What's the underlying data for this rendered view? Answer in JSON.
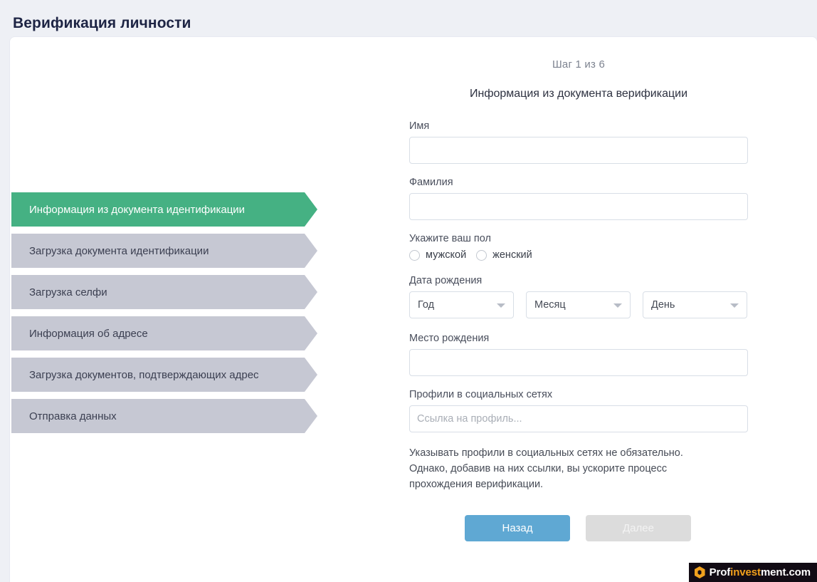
{
  "page": {
    "title": "Верификация личности",
    "colors": {
      "background": "#eef0f5",
      "card": "#ffffff",
      "step_active": "#45b183",
      "step_inactive": "#c6c8d3",
      "button_back": "#5fa8d3",
      "button_next_disabled": "#dcdcdc",
      "title_text": "#1d2444"
    }
  },
  "steps": [
    {
      "label": "Информация из документа идентификации",
      "active": true
    },
    {
      "label": "Загрузка документа идентификации",
      "active": false
    },
    {
      "label": "Загрузка селфи",
      "active": false
    },
    {
      "label": "Информация об адресе",
      "active": false
    },
    {
      "label": "Загрузка документов, подтверждающих адрес",
      "active": false
    },
    {
      "label": "Отправка данных",
      "active": false
    }
  ],
  "form": {
    "step_counter": "Шаг 1 из 6",
    "heading": "Информация из документа верификации",
    "first_name": {
      "label": "Имя",
      "value": "",
      "placeholder": ""
    },
    "last_name": {
      "label": "Фамилия",
      "value": "",
      "placeholder": ""
    },
    "gender": {
      "label": "Укажите ваш пол",
      "options": [
        {
          "label": "мужской",
          "selected": false
        },
        {
          "label": "женский",
          "selected": false
        }
      ]
    },
    "birth_date": {
      "label": "Дата рождения",
      "year": {
        "label": "Год",
        "icon": "chevron-down-icon"
      },
      "month": {
        "label": "Месяц",
        "icon": "chevron-down-icon"
      },
      "day": {
        "label": "День",
        "icon": "chevron-down-icon"
      }
    },
    "birth_place": {
      "label": "Место рождения",
      "value": "",
      "placeholder": ""
    },
    "social_profiles": {
      "label": "Профили в социальных сетях",
      "value": "",
      "placeholder": "Ссылка на профиль..."
    },
    "hint": "Указывать профили в социальных сетях не обязательно. Однако, добавив на них ссылки, вы ускорите процесс прохождения верификации."
  },
  "buttons": {
    "back": "Назад",
    "next": "Далее"
  },
  "watermark": {
    "icon": "hexagon-logo-icon",
    "text_part_1": "Prof",
    "text_part_2": "invest",
    "text_part_3": "ment.com"
  }
}
